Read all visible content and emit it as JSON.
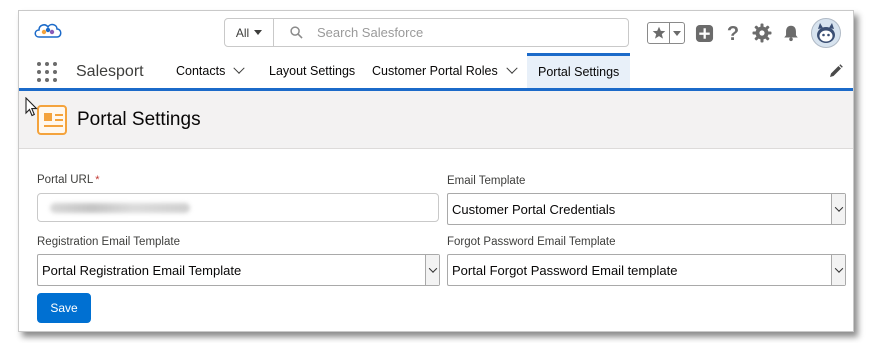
{
  "header": {
    "search_scope": "All",
    "search_placeholder": "Search Salesforce"
  },
  "nav": {
    "app_name": "Salesport",
    "items": [
      {
        "label": "Contacts",
        "has_dropdown": true
      },
      {
        "label": "Layout Settings",
        "has_dropdown": false
      },
      {
        "label": "Customer Portal Roles",
        "has_dropdown": true
      },
      {
        "label": "Portal Settings",
        "has_dropdown": false,
        "active": true
      }
    ]
  },
  "page": {
    "title": "Portal Settings"
  },
  "form": {
    "portal_url_label": "Portal URL",
    "required_marker": "*",
    "email_template_label": "Email Template",
    "email_template_value": "Customer Portal Credentials",
    "registration_email_label": "Registration Email Template",
    "registration_email_value": "Portal Registration Email Template",
    "forgot_password_label": "Forgot Password Email Template",
    "forgot_password_value": "Portal Forgot Password Email template",
    "save_label": "Save"
  },
  "colors": {
    "brand_blue": "#0070d2",
    "nav_accent": "#1b6ac9",
    "page_icon": "#f4a33c",
    "required": "#c23934"
  }
}
